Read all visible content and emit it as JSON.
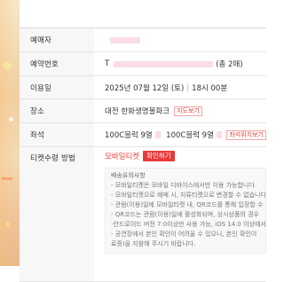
{
  "booking": {
    "booker_label": "예매자",
    "booking_number_label": "예약번호",
    "booking_number_prefix": "T",
    "booking_count": "(총 2매)",
    "date_label": "이용일",
    "date_value": "2025년 07월 12일 (토)",
    "time_separator": "|",
    "time_value": "18시 00분",
    "venue_label": "장소",
    "venue_value": "대전 한화생명볼파크",
    "map_button": "지도보기",
    "seat_label": "좌석",
    "seat_1": "100C블럭 9열",
    "seat_2": "100C블럭 9열",
    "seat_position_button": "좌석위치보기",
    "receive_label": "티켓수령 방법",
    "receive_value": "모바일티켓",
    "confirm_button": "확인하기"
  },
  "notice": {
    "title": "배송유의사항",
    "lines": [
      "- 모바일티켓은 모바일 디바이스에서만 이용 가능합니다.",
      "- 모바일티켓으로 예매 시, 지류티켓으로 변경할 수 없습니다.",
      "- 관람(이용)일에 모바일티켓 내, QR코드를 통해 입장할 수",
      "- QR코드는 관람(이용)일에 활성화되며, 상시상품의 경우",
      "-안드로이드 버전 7.0이상만 사용 가능, iOS 14.0 이상에서",
      "- 공연장에서 본인 확인이 어려울 수 있으니, 본인 확인이",
      "료증)을 지참해 주시기 바랍니다."
    ]
  },
  "colors": {
    "accent": "#e63a3a",
    "redaction": "#fbdde3",
    "label_bg": "#f7f7f7"
  }
}
